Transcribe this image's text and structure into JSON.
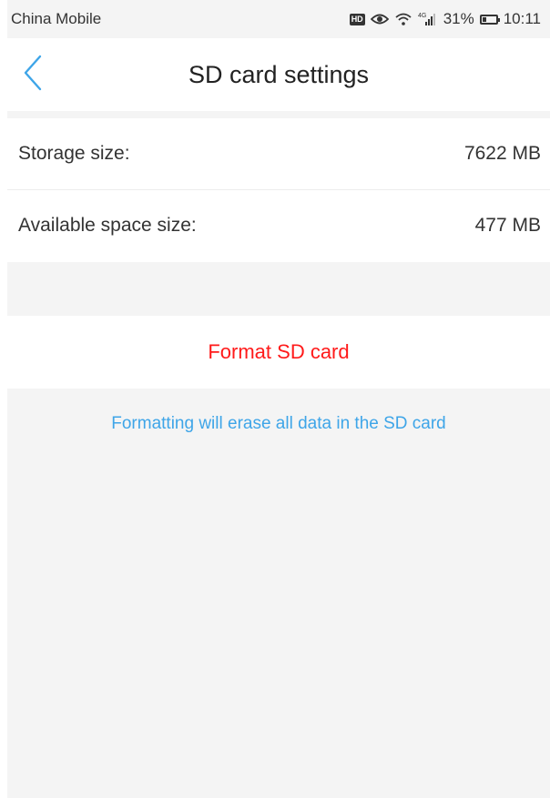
{
  "status_bar": {
    "carrier": "China Mobile",
    "hd_badge": "HD",
    "network": "4G",
    "battery_percent": "31%",
    "time": "10:11",
    "battery_level": 0.31
  },
  "header": {
    "title": "SD card settings",
    "back_icon": "chevron-left-icon"
  },
  "storage": {
    "rows": [
      {
        "label": "Storage size:",
        "value": "7622 MB"
      },
      {
        "label": "Available space size:",
        "value": "477 MB"
      }
    ]
  },
  "actions": {
    "format_label": "Format SD card",
    "format_color": "#ff1a1a"
  },
  "warning": {
    "text": "Formatting will erase all data in the SD card",
    "color": "#3ea5e8"
  },
  "colors": {
    "accent": "#3ea5e8",
    "background": "#f4f4f4"
  }
}
